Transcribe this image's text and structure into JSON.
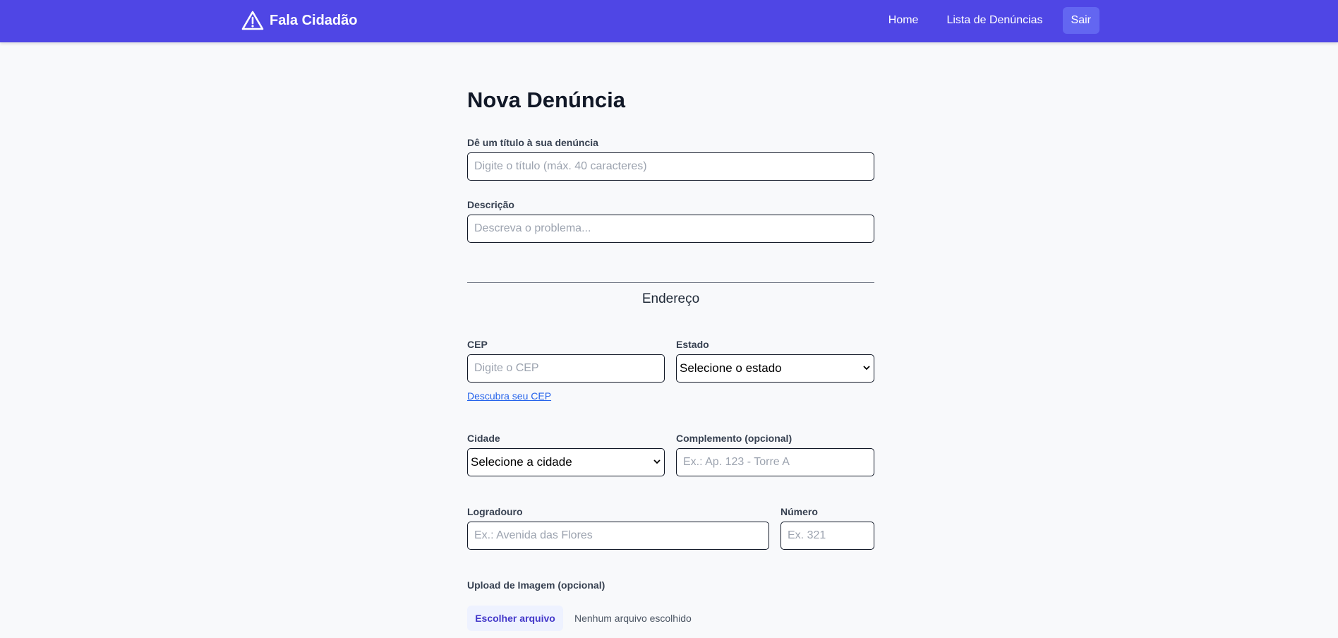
{
  "navbar": {
    "brand_name": "Fala Cidadão",
    "links": [
      {
        "label": "Home"
      },
      {
        "label": "Lista de Denúncias"
      },
      {
        "label": "Sair"
      }
    ],
    "colors": {
      "bar": "#4f46e5",
      "active": "#6366f1"
    }
  },
  "form": {
    "title": "Nova Denúncia",
    "titulo": {
      "label": "Dê um título à sua denúncia",
      "placeholder": "Digite o título (máx. 40 caracteres)",
      "value": ""
    },
    "descricao": {
      "label": "Descrição",
      "placeholder": "Descreva o problema...",
      "value": ""
    },
    "address_section": "Endereço",
    "cep": {
      "label": "CEP",
      "placeholder": "Digite o CEP",
      "value": "",
      "help_link": "Descubra seu CEP"
    },
    "estado": {
      "label": "Estado",
      "selected": "Selecione o estado"
    },
    "cidade": {
      "label": "Cidade",
      "selected": "Selecione a cidade"
    },
    "complemento": {
      "label": "Complemento (opcional)",
      "placeholder": "Ex.: Ap. 123 - Torre A",
      "value": ""
    },
    "logradouro": {
      "label": "Logradouro",
      "placeholder": "Ex.: Avenida das Flores",
      "value": ""
    },
    "numero": {
      "label": "Número",
      "placeholder": "Ex. 321",
      "value": ""
    },
    "upload": {
      "label": "Upload de Imagem (opcional)",
      "button": "Escolher arquivo",
      "status": "Nenhum arquivo escolhido"
    }
  }
}
